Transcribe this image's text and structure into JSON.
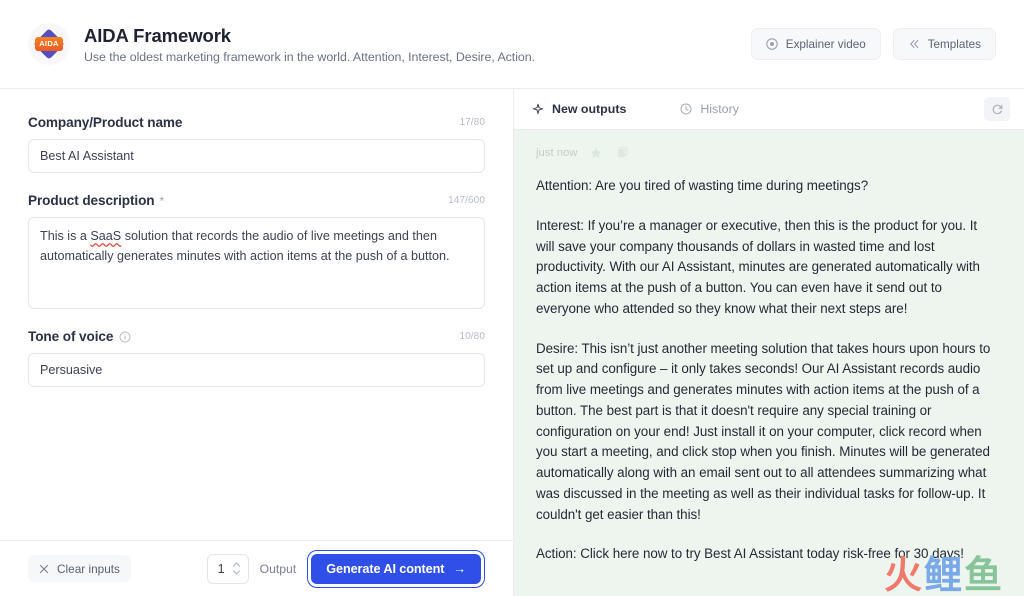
{
  "header": {
    "logo_badge": "AIDA",
    "title": "AIDA Framework",
    "subtitle": "Use the oldest marketing framework in the world. Attention, Interest, Desire, Action.",
    "explainer_button": "Explainer video",
    "templates_button": "Templates"
  },
  "form": {
    "company": {
      "label": "Company/Product name",
      "counter": "17/80",
      "value": "Best AI Assistant",
      "placeholder": "Company/Product name"
    },
    "description": {
      "label": "Product description",
      "required_mark": "*",
      "counter": "147/600",
      "value": "This is a SaaS solution that records the audio of live meetings and then automatically generates minutes with action items at the push of a button.",
      "misspelled_word": "SaaS",
      "text_before": "This is a ",
      "text_after": " solution that records the audio of live meetings and then automatically generates minutes with action items at the push of a button.",
      "placeholder": "Product description"
    },
    "tone": {
      "label": "Tone of voice",
      "counter": "10/80",
      "value": "Persuasive",
      "placeholder": "Tone of voice"
    }
  },
  "footer": {
    "clear_label": "Clear inputs",
    "output_count": "1",
    "output_label": "Output",
    "generate_label": "Generate AI content",
    "generate_arrow": "→",
    "accent_color": "#2f4fe8"
  },
  "output_panel": {
    "tabs": [
      {
        "label": "New outputs",
        "icon": "sparkle-icon",
        "active": true
      },
      {
        "label": "History",
        "icon": "clock-icon",
        "active": false
      }
    ],
    "refresh_icon": "refresh-icon",
    "timestamp": "just now",
    "star_icon": "star-icon",
    "copy_icon": "copy-icon",
    "background_color": "#eef5ef",
    "paragraphs": [
      "Attention: Are you tired of wasting time during meetings?",
      "Interest: If you’re a manager or executive, then this is the product for you. It will save your company thousands of dollars in wasted time and lost productivity. With our AI Assistant, minutes are generated automatically with action items at the push of a button. You can even have it send out to everyone who attended so they know what their next steps are!",
      "Desire: This isn’t just another meeting solution that takes hours upon hours to set up and configure – it only takes seconds! Our AI Assistant records audio from live meetings and generates minutes with action items at the push of a button. The best part is that it doesn't require any special training or configuration on your end! Just install it on your computer, click record when you start a meeting, and click stop when you finish. Minutes will be generated automatically along with an email sent out to all attendees summarizing what was discussed in the meeting as well as their individual tasks for follow-up. It couldn't get easier than this!",
      "Action: Click here now to try Best AI Assistant today risk-free for 30 days!"
    ]
  },
  "watermark": {
    "c1": "火",
    "c2": "鲤",
    "c3": "鱼"
  }
}
